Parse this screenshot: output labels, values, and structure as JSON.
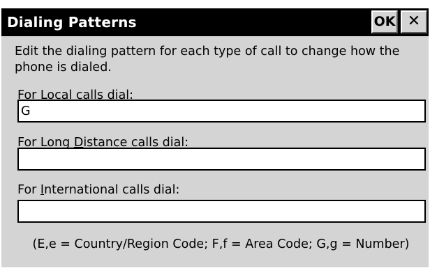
{
  "window": {
    "title": "Dialing Patterns",
    "ok_label": "OK",
    "close_glyph": "✕"
  },
  "intro_text": "Edit the dialing pattern for each type of call to change how the phone is dialed.",
  "fields": {
    "local": {
      "label_pre": "For ",
      "label_key": "L",
      "label_post": "ocal calls dial:",
      "value": "G"
    },
    "long_distance": {
      "label_pre": "For Long ",
      "label_key": "D",
      "label_post": "istance calls dial:",
      "value": ""
    },
    "international": {
      "label_pre": "For ",
      "label_key": "I",
      "label_post": "nternational calls dial:",
      "value": ""
    }
  },
  "legend_text": "(E,e = Country/Region Code; F,f = Area Code; G,g = Number)",
  "icons": {
    "close": "close-icon"
  }
}
